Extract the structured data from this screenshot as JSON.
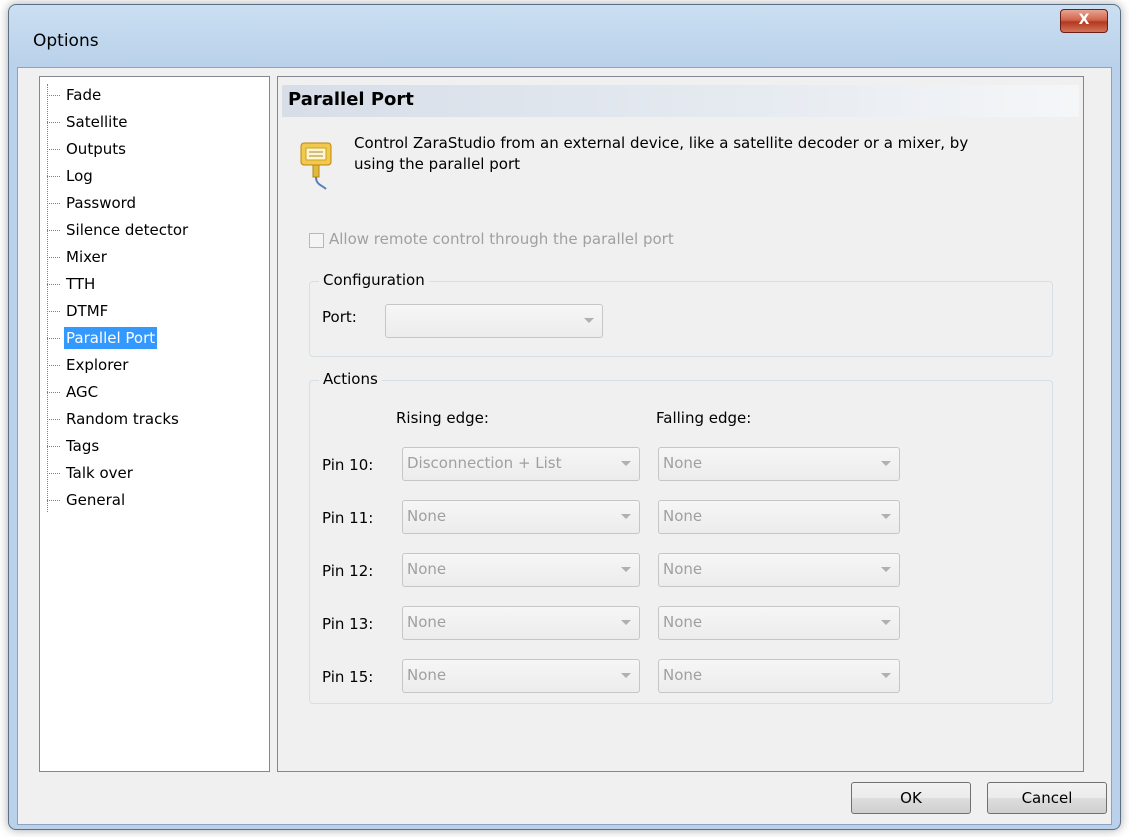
{
  "window": {
    "title": "Options",
    "close_label": "X"
  },
  "tree": {
    "items": [
      {
        "label": "Fade"
      },
      {
        "label": "Satellite"
      },
      {
        "label": "Outputs"
      },
      {
        "label": "Log"
      },
      {
        "label": "Password"
      },
      {
        "label": "Silence detector"
      },
      {
        "label": "Mixer"
      },
      {
        "label": "TTH"
      },
      {
        "label": "DTMF"
      },
      {
        "label": "Parallel Port",
        "selected": true
      },
      {
        "label": "Explorer"
      },
      {
        "label": "AGC"
      },
      {
        "label": "Random tracks"
      },
      {
        "label": "Tags"
      },
      {
        "label": "Talk over"
      },
      {
        "label": "General"
      }
    ]
  },
  "panel": {
    "title": "Parallel Port",
    "icon": "parallel-port-icon",
    "description_line1": "Control ZaraStudio from an external device, like a satellite decoder or a mixer, by",
    "description_line2": "using the parallel port",
    "allow_checkbox": {
      "label": "Allow remote control through the parallel port",
      "checked": false,
      "enabled": false
    },
    "configuration": {
      "title": "Configuration",
      "port_label": "Port:",
      "port_value": ""
    },
    "actions": {
      "title": "Actions",
      "rising_header": "Rising edge:",
      "falling_header": "Falling edge:",
      "pins": [
        {
          "label": "Pin 10:",
          "rising": "Disconnection + List",
          "falling": "None"
        },
        {
          "label": "Pin 11:",
          "rising": "None",
          "falling": "None"
        },
        {
          "label": "Pin 12:",
          "rising": "None",
          "falling": "None"
        },
        {
          "label": "Pin 13:",
          "rising": "None",
          "falling": "None"
        },
        {
          "label": "Pin 15:",
          "rising": "None",
          "falling": "None"
        }
      ]
    }
  },
  "buttons": {
    "ok": "OK",
    "cancel": "Cancel"
  },
  "colors": {
    "selection": "#3399ff",
    "disabled_text": "#a0a0a0",
    "close_red": "#c94a33"
  }
}
